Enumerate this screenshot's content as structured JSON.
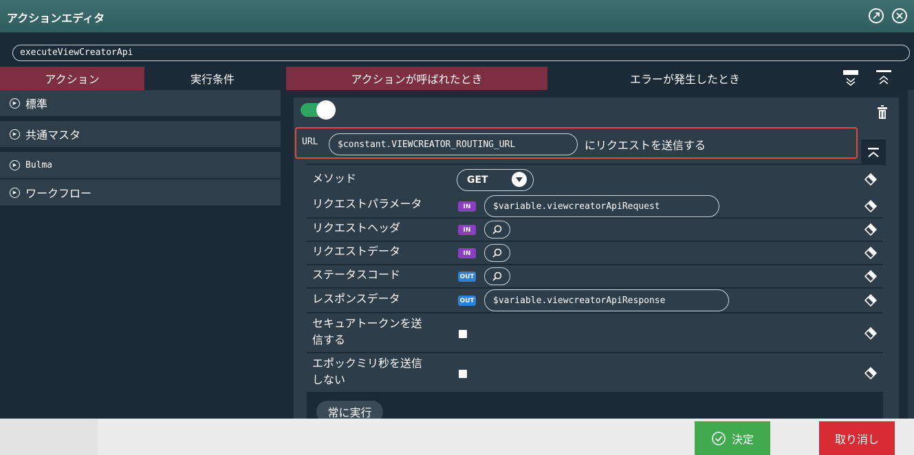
{
  "window": {
    "title": "アクションエディタ"
  },
  "action_name": "executeViewCreatorApi",
  "tabs": {
    "left": [
      {
        "label": "アクション",
        "active": true
      },
      {
        "label": "実行条件",
        "active": false
      }
    ],
    "right": [
      {
        "label": "アクションが呼ばれたとき",
        "active": true
      },
      {
        "label": "エラーが発生したとき",
        "active": false
      }
    ]
  },
  "categories": [
    {
      "label": "標準"
    },
    {
      "label": "共通マスタ"
    },
    {
      "label": "Bulma"
    },
    {
      "label": "ワークフロー"
    }
  ],
  "action": {
    "enabled": true,
    "url_label": "URL",
    "url_value": "$constant.VIEWCREATOR_ROUTING_URL",
    "url_suffix": "にリクエストを送信する",
    "params": {
      "method": {
        "label": "メソッド",
        "value": "GET"
      },
      "request_params": {
        "label": "リクエストパラメータ",
        "badge": "IN",
        "value": "$variable.viewcreatorApiRequest"
      },
      "request_headers": {
        "label": "リクエストヘッダ",
        "badge": "IN"
      },
      "request_data": {
        "label": "リクエストデータ",
        "badge": "IN"
      },
      "status_code": {
        "label": "ステータスコード",
        "badge": "OUT"
      },
      "response_data": {
        "label": "レスポンスデータ",
        "badge": "OUT",
        "value": "$variable.viewcreatorApiResponse"
      },
      "secure_token": {
        "label": "セキュアトークンを送信する",
        "line1": "セキュアトークンを送",
        "line2": "信する",
        "checked": false
      },
      "no_epoch": {
        "label": "エポックミリ秒を送信しない",
        "line1": "エポックミリ秒を送信",
        "line2": "しない",
        "checked": false
      }
    },
    "always_run_label": "常に実行"
  },
  "footer": {
    "ok_label": "決定",
    "cancel_label": "取り消し"
  },
  "colors": {
    "accent_tab": "#7d2f3f",
    "toggle_on": "#2ea560",
    "ok": "#41a94e",
    "cancel": "#d82c34",
    "highlight": "#e24b3c",
    "badge_in": "#8a3fc2",
    "badge_out": "#2f7fd3"
  }
}
